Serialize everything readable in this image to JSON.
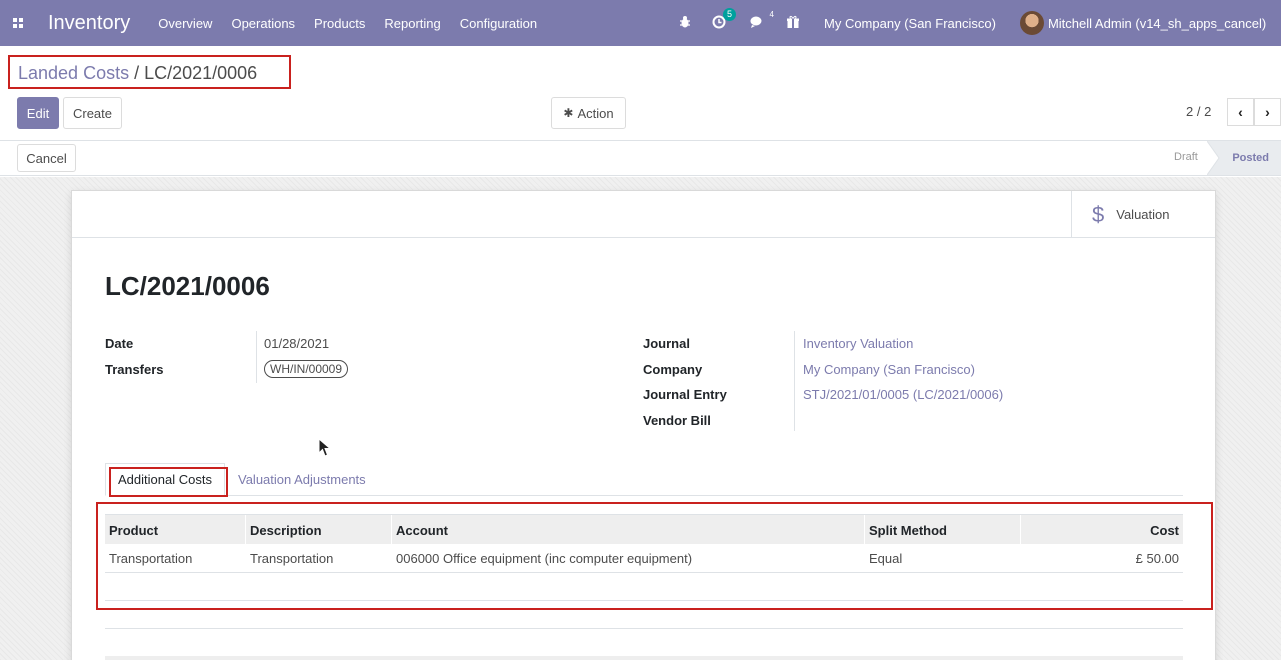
{
  "navbar": {
    "app_name": "Inventory",
    "menu": [
      "Overview",
      "Operations",
      "Products",
      "Reporting",
      "Configuration"
    ],
    "activity_count": "5",
    "messages_count": "4",
    "company": "My Company (San Francisco)",
    "user": "Mitchell Admin (v14_sh_apps_cancel)",
    "bg_color": "#7c7bad"
  },
  "breadcrumb": {
    "parent": "Landed Costs",
    "separator": " / ",
    "current": "LC/2021/0006"
  },
  "control_panel": {
    "edit_label": "Edit",
    "create_label": "Create",
    "action_label": "Action",
    "pager": "2 / 2",
    "cancel_label": "Cancel"
  },
  "status": {
    "stages": [
      "Draft",
      "Posted"
    ],
    "current": "Posted"
  },
  "form": {
    "valuation_button": "Valuation",
    "name": "LC/2021/0006",
    "left_fields": [
      {
        "label": "Date",
        "value": "01/28/2021"
      },
      {
        "label": "Transfers",
        "value": "WH/IN/00009"
      }
    ],
    "right_fields": [
      {
        "label": "Journal",
        "value": "Inventory Valuation"
      },
      {
        "label": "Company",
        "value": "My Company (San Francisco)"
      },
      {
        "label": "Journal Entry",
        "value": "STJ/2021/01/0005 (LC/2021/0006)"
      },
      {
        "label": "Vendor Bill",
        "value": ""
      }
    ],
    "tabs": [
      "Additional Costs",
      "Valuation Adjustments"
    ],
    "active_tab": "Additional Costs",
    "cost_table": {
      "columns": [
        "Product",
        "Description",
        "Account",
        "Split Method",
        "Cost"
      ],
      "rows": [
        [
          "Transportation",
          "Transportation",
          "006000 Office equipment (inc computer equipment)",
          "Equal",
          "£ 50.00"
        ]
      ]
    }
  },
  "colors": {
    "accent": "#7c7bad",
    "highlight": "#c9211e"
  }
}
